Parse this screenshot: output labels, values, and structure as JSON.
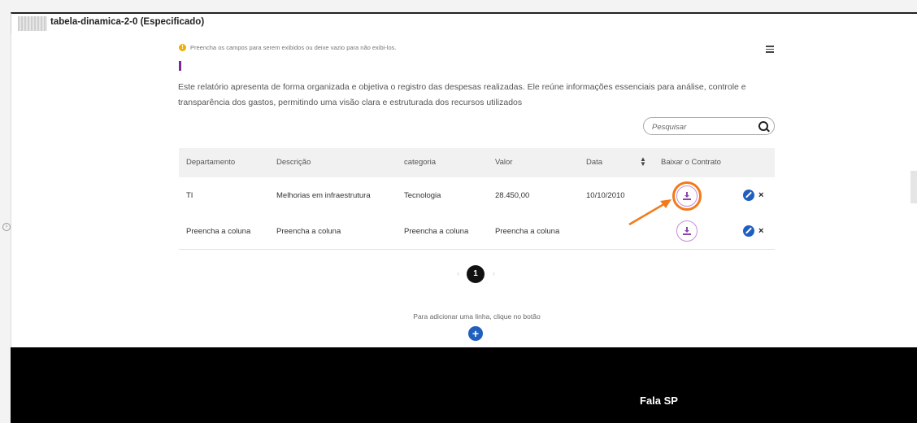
{
  "header": {
    "title": "tabela-dinamica-2-0 (Especificado)"
  },
  "notice": {
    "text": "Preencha os campos para serem exibidos ou deixe vazio para não exibi-los."
  },
  "description": "Este relatório apresenta de forma organizada e objetiva o registro das despesas realizadas. Ele reúne informações essenciais para análise, controle e transparência dos gastos, permitindo uma visão clara e estruturada dos recursos utilizados",
  "search": {
    "placeholder": "Pesquisar"
  },
  "table": {
    "columns": [
      "Departamento",
      "Descrição",
      "categoria",
      "Valor",
      "Data",
      "Baixar o Contrato"
    ],
    "rows": [
      {
        "departamento": "TI",
        "descricao": "Melhorias em infraestrutura",
        "categoria": "Tecnologia",
        "valor": "28.450,00",
        "data": "10/10/2010"
      },
      {
        "departamento": "Preencha a coluna",
        "descricao": "Preencha a coluna",
        "categoria": "Preencha a coluna",
        "valor": "Preencha a coluna",
        "data": ""
      }
    ]
  },
  "pagination": {
    "current": "1",
    "prev": "‹",
    "next": "›"
  },
  "add_row": {
    "hint": "Para adicionar uma linha, clique no botão",
    "button": "+"
  },
  "icons": {
    "info": "!",
    "delete": "×",
    "sort": "sort-icon"
  },
  "footer": {
    "title": "Fala SP"
  },
  "colors": {
    "accent": "#1f5fbf",
    "highlight": "#f27a1a",
    "download": "#8e44ad",
    "footer": "#000000"
  }
}
